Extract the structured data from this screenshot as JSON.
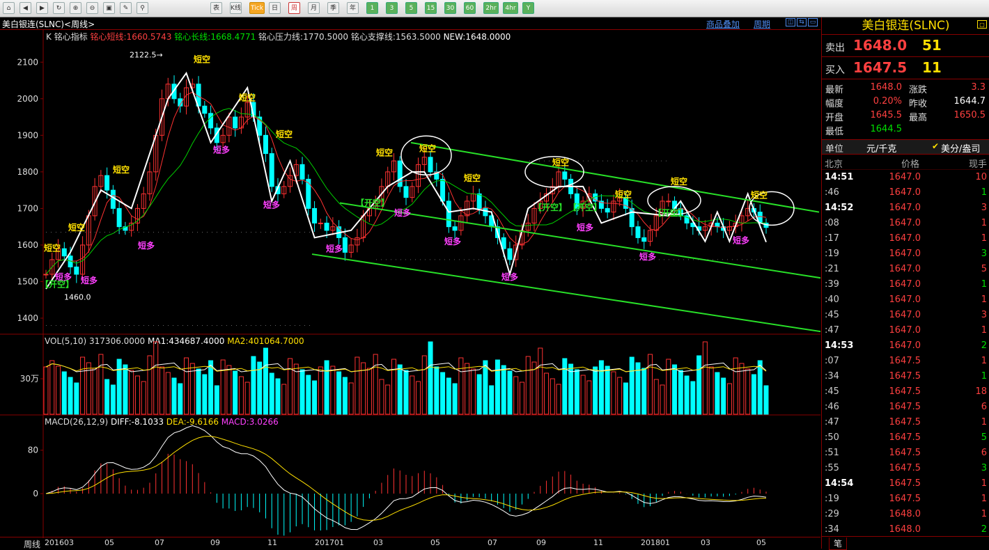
{
  "toolbar": {
    "buttons": [
      "home",
      "back",
      "fwd",
      "refresh",
      "zoom-in",
      "zoom-out",
      "picture",
      "brush",
      "filter"
    ],
    "periods": [
      "表",
      "K线",
      "Tick",
      "日",
      "周",
      "月",
      "季",
      "年",
      "1",
      "3",
      "5",
      "15",
      "30",
      "60",
      "2hr",
      "4hr",
      "Y"
    ],
    "active_period": "周"
  },
  "window": {
    "title": "美白银连(SLNC)<周线>",
    "link_overlay": "商品叠加",
    "link_period": "周期"
  },
  "indicator_header": {
    "k_label": "K",
    "name": "铭心指标",
    "short_line": "铭心短线:1660.5743",
    "long_line": "铭心长线:1668.4771",
    "pressure": "铭心压力线:1770.5000",
    "support": "铭心支撑线:1563.5000",
    "new": "NEW:1648.0000"
  },
  "vol_header": {
    "vol": "VOL(5,10) 317306.0000",
    "ma1": "MA1:434687.4000",
    "ma2": "MA2:401064.7000"
  },
  "macd_header": {
    "name": "MACD(26,12,9)",
    "diff": "DIFF:-8.1033",
    "dea": "DEA:-9.6166",
    "macd": "MACD:3.0266"
  },
  "annotations": {
    "high": "2122.5",
    "low": "1460.0",
    "short_sell": "短空",
    "short_buy": "短多",
    "open_short": "【开空】"
  },
  "bottom_bar": {
    "label": "周线",
    "dates": [
      "201603",
      "05",
      "07",
      "09",
      "11",
      "201701",
      "03",
      "05",
      "07",
      "09",
      "11",
      "201801",
      "03",
      "05"
    ]
  },
  "chart_data": {
    "type": "candlestick",
    "ylim": [
      1360,
      2150
    ],
    "yticks": [
      1400,
      1500,
      1600,
      1700,
      1800,
      1900,
      2000,
      2100
    ],
    "vol_ticks": [
      "30万"
    ],
    "macd_ticks": [
      80,
      0
    ],
    "channel_lines": [
      "upper",
      "middle",
      "lower"
    ],
    "colors": {
      "up": "#ff3232",
      "down": "#00ffff",
      "short_ma": "#ff3232",
      "long_ma": "#00d000",
      "channel": "#28e028",
      "zigzag": "#ffffff",
      "diff": "#ffffff",
      "dea": "#ffe000"
    }
  },
  "sidebar": {
    "title": "美白银连(SLNC)",
    "sell_label": "卖出",
    "sell_price": "1648.0",
    "sell_vol": "51",
    "buy_label": "买入",
    "buy_price": "1647.5",
    "buy_vol": "11",
    "stats": [
      {
        "label": "最新",
        "value": "1648.0",
        "color": "#ff4040"
      },
      {
        "label": "涨跌",
        "value": "3.3",
        "color": "#ff4040"
      },
      {
        "label": "幅度",
        "value": "0.20%",
        "color": "#ff4040"
      },
      {
        "label": "昨收",
        "value": "1644.7",
        "color": "#ffffff"
      },
      {
        "label": "开盘",
        "value": "1645.5",
        "color": "#ff4040"
      },
      {
        "label": "最高",
        "value": "1650.5",
        "color": "#ff4040"
      },
      {
        "label": "最低",
        "value": "1644.5",
        "color": "#00e000"
      }
    ],
    "unit_label": "单位",
    "unit_value": "元/千克",
    "currency_option": "美分/盎司",
    "trades_head": {
      "time": "北京",
      "price": "价格",
      "vol": "现手"
    },
    "trades": [
      {
        "time": "14:51",
        "price": "1647.0",
        "vol": "10",
        "big": true
      },
      {
        "time": ":46",
        "price": "1647.0",
        "vol": "1"
      },
      {
        "time": "14:52",
        "price": "1647.0",
        "vol": "3",
        "big": true
      },
      {
        "time": ":08",
        "price": "1647.0",
        "vol": "1"
      },
      {
        "time": ":17",
        "price": "1647.0",
        "vol": "1"
      },
      {
        "time": ":19",
        "price": "1647.0",
        "vol": "3"
      },
      {
        "time": ":21",
        "price": "1647.0",
        "vol": "5"
      },
      {
        "time": ":39",
        "price": "1647.0",
        "vol": "1"
      },
      {
        "time": ":40",
        "price": "1647.0",
        "vol": "1"
      },
      {
        "time": ":45",
        "price": "1647.0",
        "vol": "3"
      },
      {
        "time": ":47",
        "price": "1647.0",
        "vol": "1"
      },
      {
        "time": "14:53",
        "price": "1647.0",
        "vol": "2",
        "big": true
      },
      {
        "time": ":07",
        "price": "1647.5",
        "vol": "1"
      },
      {
        "time": ":34",
        "price": "1647.5",
        "vol": "1"
      },
      {
        "time": ":45",
        "price": "1647.5",
        "vol": "18"
      },
      {
        "time": ":46",
        "price": "1647.5",
        "vol": "6"
      },
      {
        "time": ":47",
        "price": "1647.5",
        "vol": "1"
      },
      {
        "time": ":50",
        "price": "1647.5",
        "vol": "5"
      },
      {
        "time": ":51",
        "price": "1647.5",
        "vol": "6"
      },
      {
        "time": ":55",
        "price": "1647.5",
        "vol": "3"
      },
      {
        "time": "14:54",
        "price": "1647.5",
        "vol": "1",
        "big": true
      },
      {
        "time": ":19",
        "price": "1647.5",
        "vol": "1"
      },
      {
        "time": ":29",
        "price": "1648.0",
        "vol": "1"
      },
      {
        "time": ":34",
        "price": "1648.0",
        "vol": "2"
      }
    ],
    "foot_tab": "笔"
  }
}
